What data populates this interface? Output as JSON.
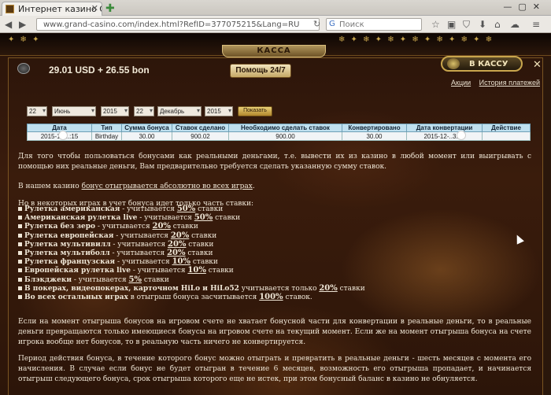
{
  "browser": {
    "tab_title": "Интернет казино G...",
    "url": "www.grand-casino.com/index.html?RefID=377075215&Lang=RU",
    "search_placeholder": "Поиск"
  },
  "header": {
    "kassa": "КАССА",
    "balance": "29.01 USD + 26.55 bon",
    "help": "Помощь 24/7",
    "to_cashier": "В КАССУ",
    "links": [
      "Акции",
      "История платежей"
    ]
  },
  "filters": {
    "day_from": "22",
    "month_from": "Июнь",
    "year_from": "2015",
    "day_to": "22",
    "month_to": "Декабрь",
    "year_to": "2015",
    "show": "Показать"
  },
  "table": {
    "headers": [
      "Дата",
      "Тип",
      "Сумма бонуса",
      "Ставок сделано",
      "Необходимо сделать ставок",
      "Конвертировано",
      "Дата конвертации",
      "Действие"
    ],
    "rows": [
      [
        "2015-12-..:15",
        "Birthday",
        "30.00",
        "900.02",
        "900.00",
        "30.00",
        "2015-12-..3:12",
        ""
      ]
    ]
  },
  "text": {
    "p1": "Для того чтобы пользоваться бонусами как реальными деньгами, т.е. вывести их из казино в любой момент или выигрывать с помощью них реальные деньги, Вам предварительно требуется сделать указанную сумму ставок.",
    "p2a": "В нашем казино ",
    "p2b": "бонус отыгрывается абсолютно во всех играх",
    "p3": "Но в некоторых играх в учет бонуса идет только часть ставки:",
    "p4": "Если на момент отыгрыша бонусов на игровом счете не хватает бонусной части для конвертации в реальные деньги, то в реальные деньги превращаются только имеющиеся бонусы на игровом счете на текущий момент. Если же на момент отыгрыша бонуса на счете игрока вообще нет бонусов, то в реальную часть ничего не конвертируется.",
    "p5": "Период действия бонуса, в течение которого бонус можно отыграть и превратить в реальные деньги - шесть месяцев с момента его начисления. В случае если бонус не будет отыгран в течение 6 месяцев, возможность его отыгрыша пропадает, и начинается отыгрыш следующего бонуса, срок отыгрыша которого еще не истек, при этом бонусный баланс в казино не обнуляется."
  },
  "games": [
    {
      "name": "Рулетка американская",
      "mid": " - учитывается ",
      "pct": "50%",
      "end": " ставки"
    },
    {
      "name": "Американская рулетка live",
      "mid": " - учитывается ",
      "pct": "50%",
      "end": " ставки"
    },
    {
      "name": "Рулетка без зеро",
      "mid": " - учитывается ",
      "pct": "20%",
      "end": " ставки"
    },
    {
      "name": "Рулетка европейская",
      "mid": " - учитывается ",
      "pct": "20%",
      "end": " ставки"
    },
    {
      "name": "Рулетка мультивилл",
      "mid": " - учитывается ",
      "pct": "20%",
      "end": " ставки"
    },
    {
      "name": "Рулетка мультиболл",
      "mid": " - учитывается ",
      "pct": "20%",
      "end": " ставки"
    },
    {
      "name": "Рулетка французская",
      "mid": " - учитывается ",
      "pct": "10%",
      "end": " ставки"
    },
    {
      "name": "Европейская рулетка live",
      "mid": " - учитывается ",
      "pct": "10%",
      "end": " ставки"
    },
    {
      "name": "Блэкджеки",
      "mid": " - учитывается ",
      "pct": "5%",
      "end": " ставки"
    },
    {
      "name": "В покерах, видеопокерах, карточном HiLo и HiLo52",
      "mid": " учитывается только ",
      "pct": "20%",
      "end": " ставки"
    },
    {
      "name": "Во всех остальных играх",
      "mid": " в отыгрыш бонуса засчитывается ",
      "pct": "100%",
      "end": " ставок."
    }
  ]
}
